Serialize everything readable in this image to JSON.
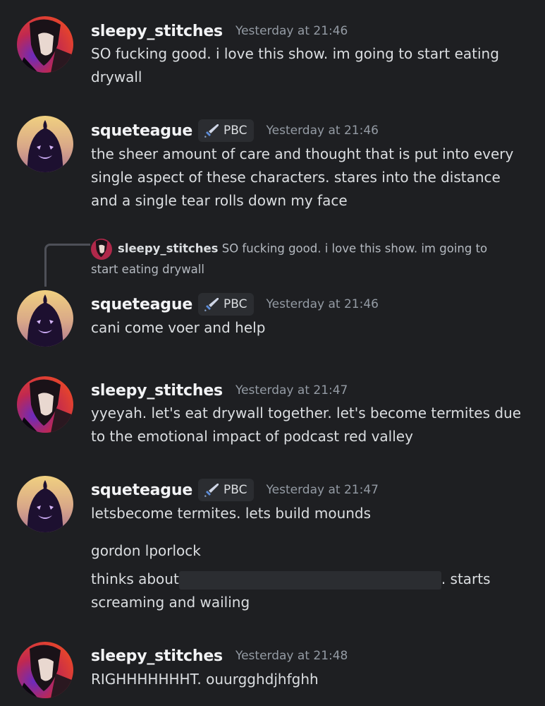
{
  "messages": [
    {
      "user": "sleepy_stitches",
      "time": "Yesterday at 21:46",
      "text": "SO fucking good. i love this show. im going to start eating drywall"
    },
    {
      "user": "squeteague",
      "tag": "PBC",
      "time": "Yesterday at 21:46",
      "text": "the sheer amount of care and thought that is put into every single aspect of these characters. stares into the distance and a single tear rolls down my face"
    },
    {
      "user": "squeteague",
      "tag": "PBC",
      "time": "Yesterday at 21:46",
      "text": "cani come voer and help",
      "reply": {
        "user": "sleepy_stitches",
        "text": "SO fucking good. i love this show. im going to start eating drywall"
      }
    },
    {
      "user": "sleepy_stitches",
      "time": "Yesterday at 21:47",
      "text": "yyeyah. let's eat drywall together. let's become termites due to the emotional impact of podcast red valley"
    },
    {
      "user": "squeteague",
      "tag": "PBC",
      "time": "Yesterday at 21:47",
      "text": "letsbecome termites. lets build mounds",
      "followups": [
        "gordon lporlock"
      ],
      "redacted_line": {
        "before": "thinks about",
        "after": ". starts",
        "continuation": "screaming and wailing"
      }
    },
    {
      "user": "sleepy_stitches",
      "time": "Yesterday at 21:48",
      "text": "RIGHHHHHHHT. ouurgghdjhfghh"
    }
  ],
  "icons": {
    "tag_icon": "sword-icon"
  },
  "colors": {
    "background": "#1e1f22",
    "username": "#f2f3f5",
    "text": "#dbdee1",
    "timestamp": "#949ba4",
    "tag_bg": "#2b2d31"
  }
}
